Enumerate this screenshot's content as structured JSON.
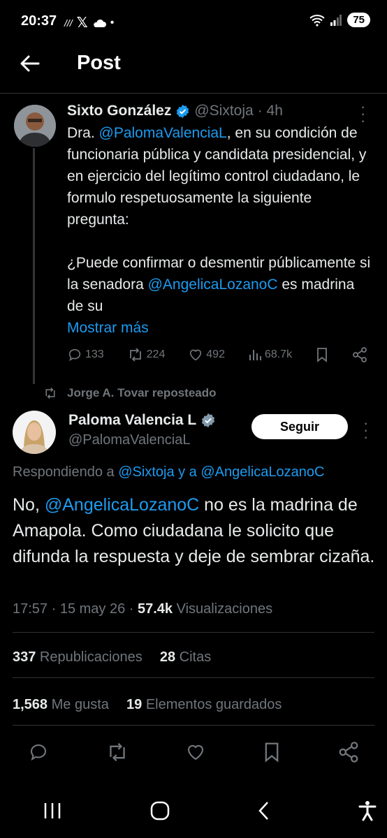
{
  "status": {
    "time": "20:37",
    "battery": "75"
  },
  "header": {
    "title": "Post"
  },
  "parent_post": {
    "author_name": "Sixto González",
    "handle": "@Sixtoja",
    "time": "· 4h",
    "text_prefix": "Dra. ",
    "mention1": "@PalomaValenciaL",
    "text_p1_rest": ", en su condición de funcionaria pública y candidata presidencial, y en ejercicio del legítimo control ciudadano, le formulo respetuosamente la siguiente pregunta:",
    "text_p2": "¿Puede confirmar o desmentir públicamente si la senadora ",
    "mention2": "@AngelicaLozanoC",
    "text_p2_rest": " es madrina de su",
    "show_more": "Mostrar más",
    "replies": "133",
    "reposts": "224",
    "likes": "492",
    "views": "68.7k"
  },
  "repost_label": "Jorge A. Tovar reposteado",
  "main_post": {
    "author_name": "Paloma Valencia L",
    "handle": "@PalomaValenciaL",
    "follow_label": "Seguir",
    "replying_prefix": "Respondiendo a ",
    "replying_to": "@Sixtoja y a @AngelicaLozanoC",
    "text_prefix": "No, ",
    "mention": "@AngelicaLozanoC",
    "text_rest": " no es la madrina de Amapola. Como ciudadana le solicito que difunda la respuesta y deje de sembrar cizaña.",
    "timestamp": "17:57 · 15 may 26 · ",
    "views_count": "57.4k",
    "views_label": " Visualizaciones",
    "reposts_count": "337",
    "reposts_label": " Republicaciones",
    "quotes_count": "28",
    "quotes_label": " Citas",
    "likes_count": "1,568",
    "likes_label": " Me gusta",
    "bookmarks_count": "19",
    "bookmarks_label": " Elementos guardados"
  }
}
